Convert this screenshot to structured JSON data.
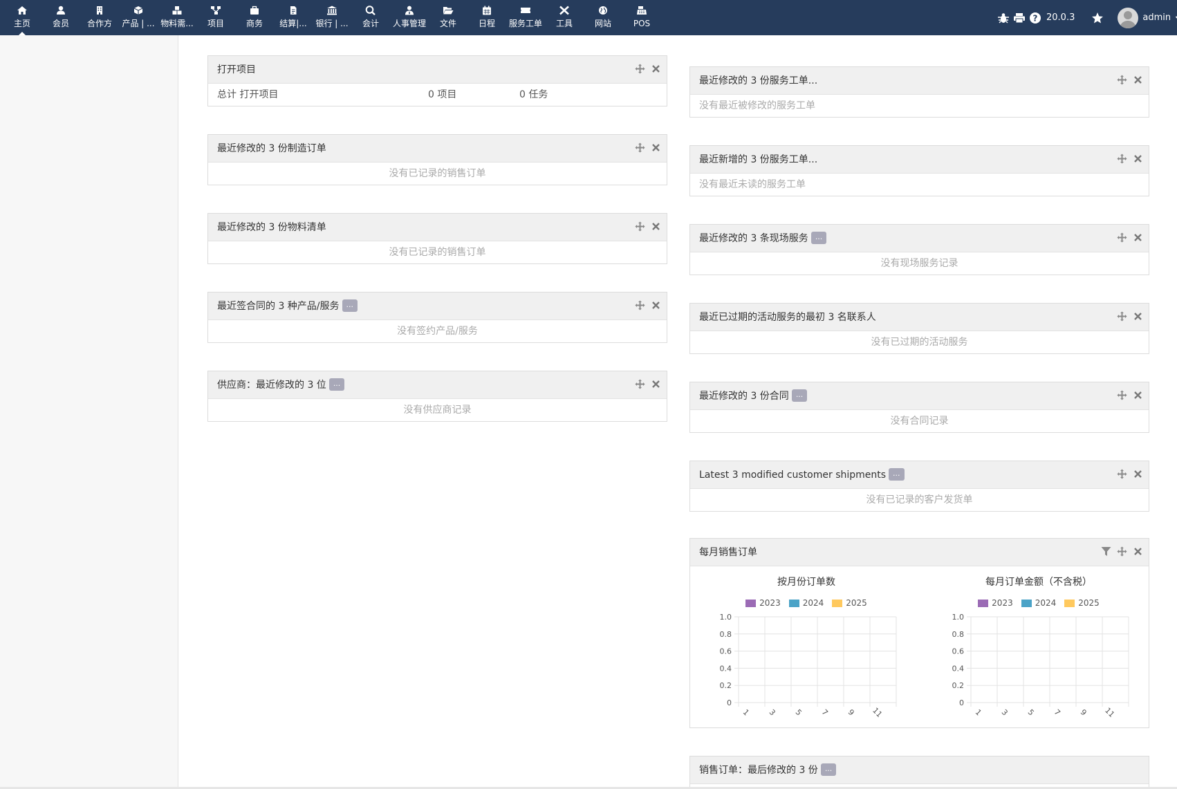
{
  "nav": {
    "items": [
      {
        "label": "主页",
        "icon": "home-icon"
      },
      {
        "label": "会员",
        "icon": "user-icon"
      },
      {
        "label": "合作方",
        "icon": "building-icon"
      },
      {
        "label": "产品 | ...",
        "icon": "cube-icon"
      },
      {
        "label": "物料需...",
        "icon": "cubes-icon"
      },
      {
        "label": "项目",
        "icon": "sitemap-icon"
      },
      {
        "label": "商务",
        "icon": "briefcase-icon"
      },
      {
        "label": "结算|...",
        "icon": "file-invoice-icon"
      },
      {
        "label": "银行 | ...",
        "icon": "bank-icon"
      },
      {
        "label": "会计",
        "icon": "search-dollar-icon"
      },
      {
        "label": "人事管理",
        "icon": "user-tie-icon"
      },
      {
        "label": "文件",
        "icon": "folder-open-icon"
      },
      {
        "label": "日程",
        "icon": "calendar-icon"
      },
      {
        "label": "服务工单",
        "icon": "ticket-icon"
      },
      {
        "label": "工具",
        "icon": "tools-icon"
      },
      {
        "label": "网站",
        "icon": "globe-icon"
      },
      {
        "label": "POS",
        "icon": "cash-register-icon"
      }
    ],
    "version": "20.0.3",
    "username": "admin"
  },
  "left_column": {
    "open_projects": {
      "title": "打开项目",
      "total_label": "总计 打开项目",
      "projects": "0 项目",
      "tasks": "0 任务"
    },
    "boxes": [
      {
        "title": "最近修改的 3 份制造订单",
        "empty": "没有已记录的销售订单",
        "more": ""
      },
      {
        "title": "最近修改的 3 份物料清单",
        "empty": "没有已记录的销售订单",
        "more": ""
      },
      {
        "title": "最近签合同的 3 种产品/服务",
        "empty": "没有签约产品/服务",
        "more": "..."
      },
      {
        "title": "供应商：最近修改的 3 位",
        "empty": "没有供应商记录",
        "more": "..."
      }
    ]
  },
  "right_column": {
    "boxes": [
      {
        "title": "最近修改的 3 份服务工单...",
        "empty": "没有最近被修改的服务工单",
        "more": "",
        "align": "left"
      },
      {
        "title": "最近新增的 3 份服务工单...",
        "empty": "没有最近未读的服务工单",
        "more": "",
        "align": "left"
      },
      {
        "title": "最近修改的 3 条现场服务",
        "empty": "没有现场服务记录",
        "more": "...",
        "align": "center"
      },
      {
        "title": "最近已过期的活动服务的最初 3 名联系人",
        "empty": "没有已过期的活动服务",
        "more": "",
        "align": "center"
      },
      {
        "title": "最近修改的 3 份合同",
        "empty": "没有合同记录",
        "more": "...",
        "align": "center"
      },
      {
        "title": "Latest 3 modified customer shipments",
        "empty": "没有已记录的客户发货单",
        "more": "...",
        "align": "center"
      }
    ],
    "monthly_sales": {
      "title": "每月销售订单"
    },
    "last_box": {
      "title": "销售订单：最后修改的 3 份",
      "more": "..."
    }
  },
  "colors": {
    "nav_bg": "#263c5c",
    "series_2023": "#9b6bb5",
    "series_2024": "#4ba3c7",
    "series_2025": "#ffc95e"
  },
  "chart_data": [
    {
      "type": "bar",
      "title": "按月份订单数",
      "legend_position": "top",
      "categories": [
        "1",
        "3",
        "5",
        "7",
        "9",
        "11"
      ],
      "series": [
        {
          "name": "2023",
          "values": [
            0,
            0,
            0,
            0,
            0,
            0
          ]
        },
        {
          "name": "2024",
          "values": [
            0,
            0,
            0,
            0,
            0,
            0
          ]
        },
        {
          "name": "2025",
          "values": [
            0,
            0,
            0,
            0,
            0,
            0
          ]
        }
      ],
      "yticks": [
        "0",
        "0.2",
        "0.4",
        "0.6",
        "0.8",
        "1.0"
      ],
      "ylim": [
        0,
        1
      ],
      "grid": true
    },
    {
      "type": "bar",
      "title": "每月订单金额（不含税）",
      "legend_position": "top",
      "categories": [
        "1",
        "3",
        "5",
        "7",
        "9",
        "11"
      ],
      "series": [
        {
          "name": "2023",
          "values": [
            0,
            0,
            0,
            0,
            0,
            0
          ]
        },
        {
          "name": "2024",
          "values": [
            0,
            0,
            0,
            0,
            0,
            0
          ]
        },
        {
          "name": "2025",
          "values": [
            0,
            0,
            0,
            0,
            0,
            0
          ]
        }
      ],
      "yticks": [
        "0",
        "0.2",
        "0.4",
        "0.6",
        "0.8",
        "1.0"
      ],
      "ylim": [
        0,
        1
      ],
      "grid": true
    }
  ]
}
